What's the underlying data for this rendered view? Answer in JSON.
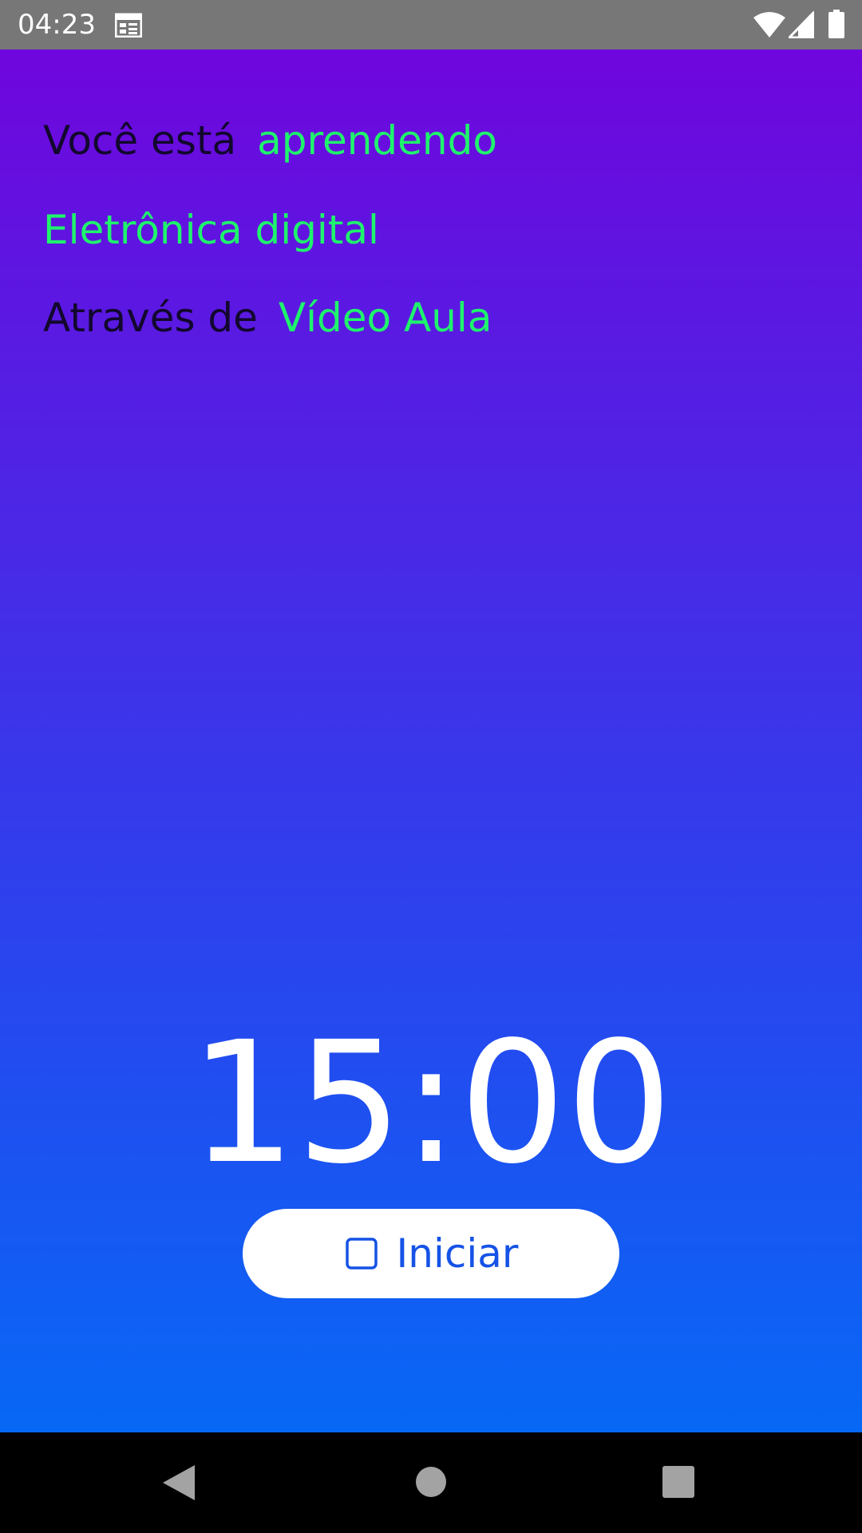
{
  "status_bar": {
    "time": "04:23",
    "icons": [
      "calendar-icon",
      "wifi-icon",
      "signal-icon",
      "battery-icon"
    ],
    "background": "#777777"
  },
  "lesson": {
    "row1_label": "Você está",
    "row1_value": "aprendendo",
    "subject": "Eletrônica digital",
    "row3_label": "Através de",
    "row3_value": "Vídeo Aula"
  },
  "timer": {
    "display": "15:00"
  },
  "start_button": {
    "label": "Iniciar",
    "icon": "stop-square-icon"
  },
  "nav_bar": {
    "items": [
      "back-icon",
      "home-icon",
      "recents-icon"
    ]
  },
  "colors": {
    "gradient_top": "#6f06dd",
    "gradient_bottom": "#0768f5",
    "highlight_text": "#1ef56c",
    "label_text": "#12082e",
    "button_text": "#1552e6"
  }
}
